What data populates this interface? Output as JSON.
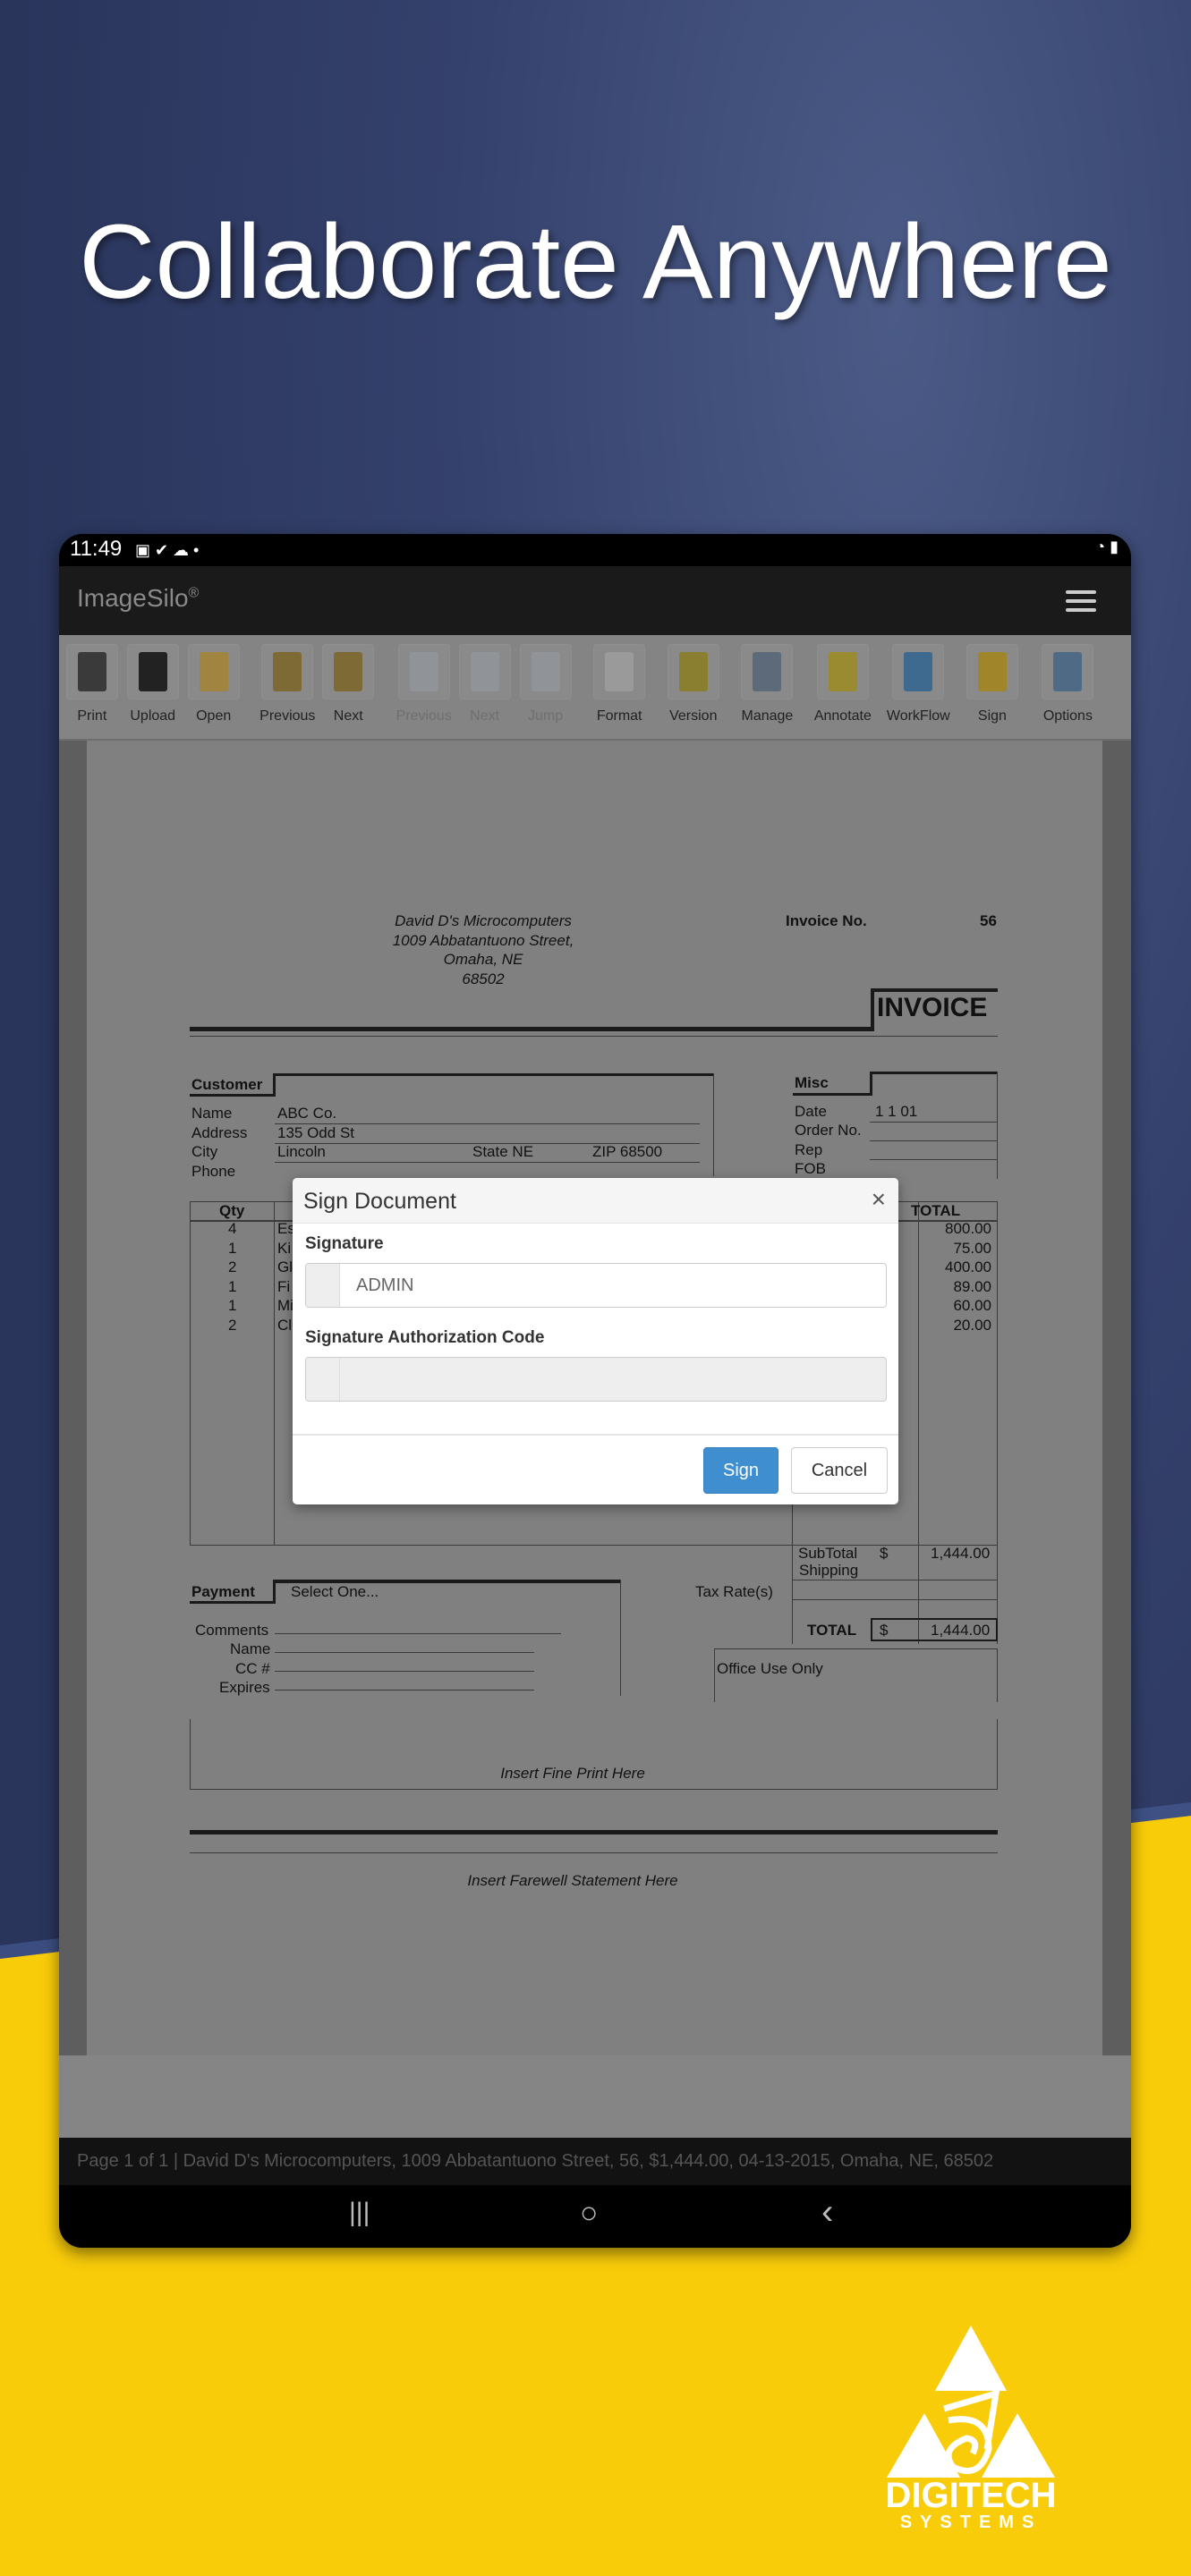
{
  "headline": "Collaborate Anywhere",
  "status_bar": {
    "time": "11:49"
  },
  "app": {
    "brand": "ImageSilo",
    "brand_mark": "®"
  },
  "toolbar": [
    {
      "label": "Print",
      "icon": "printer-icon",
      "enabled": true,
      "color": "#3a3a3a"
    },
    {
      "label": "Upload",
      "icon": "floppy-disk-icon",
      "enabled": true,
      "color": "#222222"
    },
    {
      "label": "Open",
      "icon": "folder-open-icon",
      "enabled": true,
      "color": "#a08440"
    },
    {
      "label": "Previous",
      "icon": "folder-previous-icon",
      "enabled": true,
      "color": "#7d6a35"
    },
    {
      "label": "Next",
      "icon": "folder-next-icon",
      "enabled": true,
      "color": "#7d6a35"
    },
    {
      "label": "Previous",
      "icon": "page-previous-icon",
      "enabled": false,
      "color": "#9aa7b5"
    },
    {
      "label": "Next",
      "icon": "page-next-icon",
      "enabled": false,
      "color": "#9aa7b5"
    },
    {
      "label": "Jump",
      "icon": "page-jump-icon",
      "enabled": false,
      "color": "#9aa7b5"
    },
    {
      "label": "Format",
      "icon": "format-wrench-icon",
      "enabled": true,
      "color": "#9a9a9a"
    },
    {
      "label": "Version",
      "icon": "version-lock-icon",
      "enabled": true,
      "color": "#8a7e30"
    },
    {
      "label": "Manage",
      "icon": "manage-gear-icon",
      "enabled": true,
      "color": "#5d6a7a"
    },
    {
      "label": "Annotate",
      "icon": "annotate-note-icon",
      "enabled": true,
      "color": "#9a8a30"
    },
    {
      "label": "WorkFlow",
      "icon": "workflow-icon",
      "enabled": true,
      "color": "#3f6a8f"
    },
    {
      "label": "Sign",
      "icon": "pencil-icon",
      "enabled": true,
      "color": "#a0852a"
    },
    {
      "label": "Options",
      "icon": "clipboard-options-icon",
      "enabled": true,
      "color": "#4f6a85"
    }
  ],
  "invoice": {
    "company": [
      "David D's Microcomputers",
      "1009 Abbatantuono Street,",
      "Omaha, NE",
      "68502"
    ],
    "invoice_no_label": "Invoice No.",
    "invoice_no": "56",
    "title": "INVOICE",
    "customer_label": "Customer",
    "name_label": "Name",
    "name": "ABC Co.",
    "address_label": "Address",
    "address": "135 Odd St",
    "city_label": "City",
    "city": "Lincoln",
    "state": "State NE",
    "zip": "ZIP 68500",
    "phone_label": "Phone",
    "misc_label": "Misc",
    "date_label": "Date",
    "date": "1 1 01",
    "order_label": "Order No.",
    "rep_label": "Rep",
    "fob_label": "FOB",
    "qty_header": "Qty",
    "total_header": "TOTAL",
    "rows": [
      {
        "qty": "4",
        "desc": "Es",
        "total": "800.00"
      },
      {
        "qty": "1",
        "desc": "Ki",
        "total": "75.00"
      },
      {
        "qty": "2",
        "desc": "Gl",
        "total": "400.00"
      },
      {
        "qty": "1",
        "desc": "Fi",
        "total": "89.00"
      },
      {
        "qty": "1",
        "desc": "Mi",
        "total": "60.00"
      },
      {
        "qty": "2",
        "desc": "Cl",
        "total": "20.00"
      }
    ],
    "subtotal_label": "SubTotal",
    "currency": "$",
    "subtotal": "1,444.00",
    "shipping_label": "Shipping",
    "tax_label": "Tax Rate(s)",
    "grand_total_label": "TOTAL",
    "grand_total": "1,444.00",
    "payment_label": "Payment",
    "payment_value": "Select One...",
    "comments_label": "Comments",
    "pname_label": "Name",
    "cc_label": "CC #",
    "expires_label": "Expires",
    "office_label": "Office Use Only",
    "fine_print": "Insert Fine Print Here",
    "farewell": "Insert Farewell Statement Here"
  },
  "dialog": {
    "title": "Sign Document",
    "close": "×",
    "signature_label": "Signature",
    "signature_value": "ADMIN",
    "auth_label": "Signature Authorization Code",
    "auth_value": "",
    "sign_button": "Sign",
    "cancel_button": "Cancel"
  },
  "footer": "Page 1 of 1 | David D's Microcomputers, 1009 Abbatantuono Street, 56, $1,444.00, 04-13-2015, Omaha, NE, 68502",
  "nav": {
    "recents": "|||",
    "home": "○",
    "back": "‹"
  },
  "logo": {
    "name": "DIGITECH",
    "sub": "SYSTEMS"
  },
  "colors": {
    "accent": "#3e8ed0",
    "navy": "#2e3a63",
    "yellow": "#f9cc0a"
  }
}
